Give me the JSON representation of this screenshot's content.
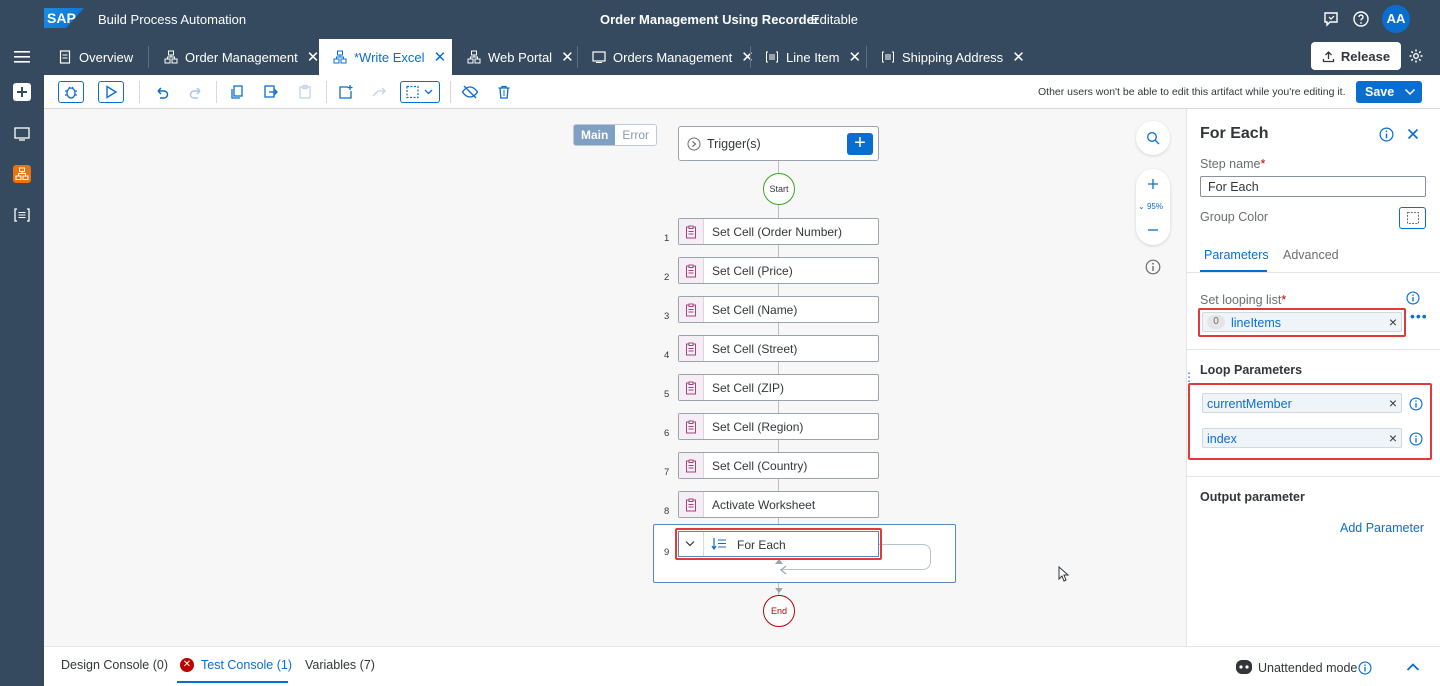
{
  "shell": {
    "logo": "SAP",
    "product": "Build Process Automation",
    "project_title": "Order Management Using Recorder",
    "status": "Editable",
    "avatar": "AA"
  },
  "tabs": [
    {
      "label": "Overview",
      "icon": "document-icon",
      "closable": false
    },
    {
      "label": "Order Management",
      "icon": "process-icon",
      "closable": true
    },
    {
      "label": "*Write Excel",
      "icon": "process-icon",
      "closable": true,
      "active": true
    },
    {
      "label": "Web Portal",
      "icon": "process-icon",
      "closable": true
    },
    {
      "label": "Orders Management",
      "icon": "screen-icon",
      "closable": true
    },
    {
      "label": "Line Item",
      "icon": "datatype-icon",
      "closable": true
    },
    {
      "label": "Shipping Address",
      "icon": "datatype-icon",
      "closable": true
    }
  ],
  "release_label": "Release",
  "toolbar": {
    "lock_message": "Other users won't be able to edit this artifact while you're editing it.",
    "save_label": "Save"
  },
  "canvas": {
    "switch_main": "Main",
    "switch_error": "Error",
    "trigger_label": "Trigger(s)",
    "start_label": "Start",
    "end_label": "End",
    "zoom_level": "95%",
    "steps": [
      {
        "num": "1",
        "label": "Set Cell (Order Number)"
      },
      {
        "num": "2",
        "label": "Set Cell (Price)"
      },
      {
        "num": "3",
        "label": "Set Cell (Name)"
      },
      {
        "num": "4",
        "label": "Set Cell (Street)"
      },
      {
        "num": "5",
        "label": "Set Cell (ZIP)"
      },
      {
        "num": "6",
        "label": "Set Cell (Region)"
      },
      {
        "num": "7",
        "label": "Set Cell (Country)"
      },
      {
        "num": "8",
        "label": "Activate Worksheet"
      }
    ],
    "foreach": {
      "num": "9",
      "label": "For Each"
    }
  },
  "panel": {
    "title": "For Each",
    "step_name_label": "Step name",
    "step_name_value": "For Each",
    "group_color_label": "Group Color",
    "tab_parameters": "Parameters",
    "tab_advanced": "Advanced",
    "looping_label": "Set looping list",
    "looping_index": "0",
    "looping_value": "lineItems",
    "loop_params_title": "Loop Parameters",
    "loop_params": [
      "currentMember",
      "index"
    ],
    "output_title": "Output parameter",
    "add_parameter": "Add Parameter"
  },
  "console": {
    "design": "Design Console (0)",
    "test": "Test Console (1)",
    "variables": "Variables (7)",
    "mode": "Unattended mode"
  },
  "colors": {
    "shell": "#354a5f",
    "accent": "#0a6ed1",
    "highlight": "#e03a3a",
    "error": "#bb0000"
  }
}
